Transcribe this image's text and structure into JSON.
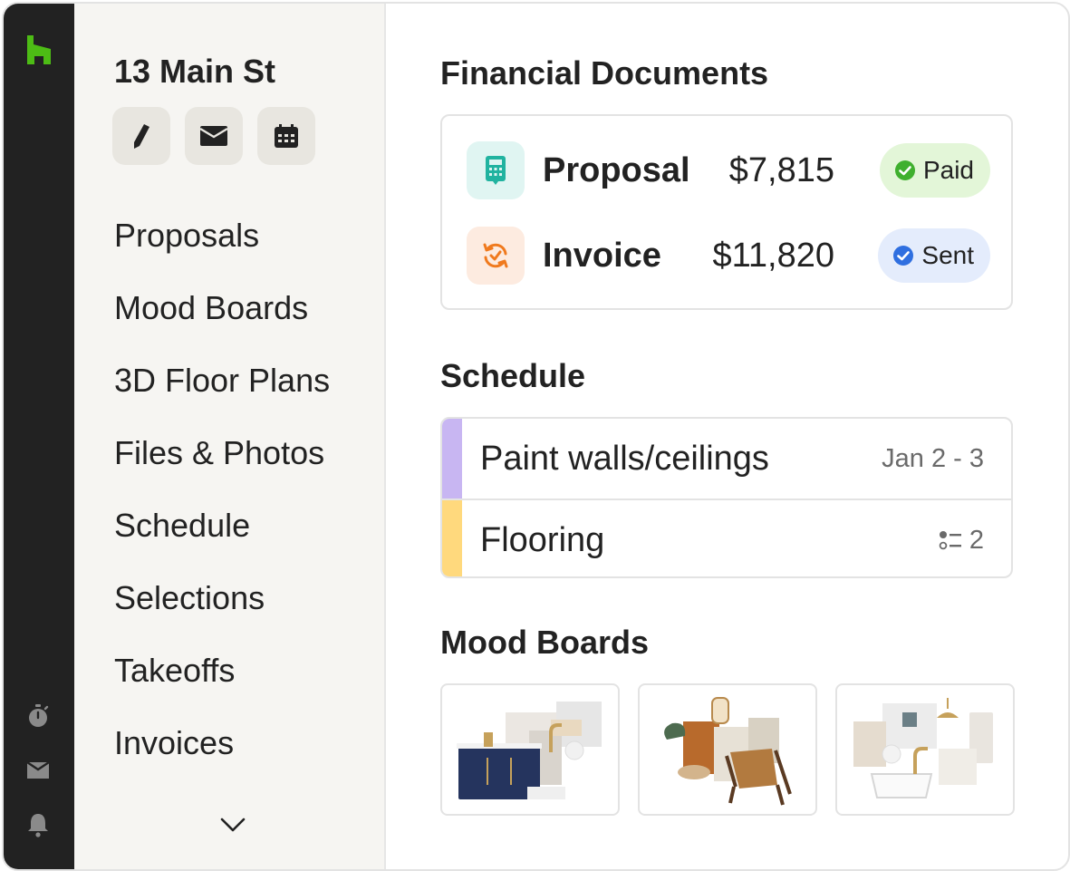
{
  "project": {
    "title": "13 Main St"
  },
  "actions": [
    {
      "icon": "pencil-icon"
    },
    {
      "icon": "envelope-icon"
    },
    {
      "icon": "calendar-icon"
    }
  ],
  "nav": {
    "items": [
      "Proposals",
      "Mood Boards",
      "3D Floor Plans",
      "Files & Photos",
      "Schedule",
      "Selections",
      "Takeoffs",
      "Invoices"
    ]
  },
  "financial": {
    "title": "Financial Documents",
    "docs": [
      {
        "name": "Proposal",
        "amount": "$7,815",
        "status": "Paid",
        "icon": "calculator-icon"
      },
      {
        "name": "Invoice",
        "amount": "$11,820",
        "status": "Sent",
        "icon": "refresh-check-icon"
      }
    ]
  },
  "schedule": {
    "title": "Schedule",
    "items": [
      {
        "name": "Paint walls/ceilings",
        "meta": "Jan 2 - 3",
        "color": "#c8b6f2"
      },
      {
        "name": "Flooring",
        "meta": "2",
        "meta_icon": "checklist-icon",
        "color": "#ffd97d"
      }
    ]
  },
  "mood_boards": {
    "title": "Mood Boards"
  },
  "colors": {
    "brand_green": "#4dbc15",
    "rail": "#222222",
    "paid_bg": "#e3f6d8",
    "sent_bg": "#e4ecfc",
    "paid": "#3fb02e",
    "sent": "#2f6fe0"
  }
}
